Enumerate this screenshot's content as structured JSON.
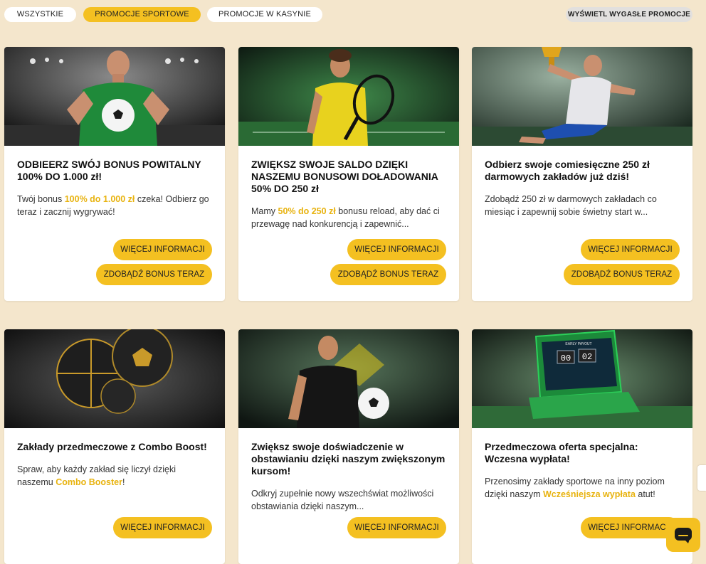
{
  "filters": {
    "all": "WSZYSTKIE",
    "sport": "PROMOCJE SPORTOWE",
    "casino": "PROMOCJE W KASYNIE",
    "expired": "WYŚWIETL WYGASŁE PROMOCJE"
  },
  "colors": {
    "accent": "#f4c021",
    "background": "#f4e6cc",
    "highlight": "#e8b30f"
  },
  "cards": [
    {
      "title": "ODBIEERZ SWÓJ BONUS POWITALNY 100% DO 1.000 zł!",
      "text_before": "Twój bonus ",
      "text_highlight": "100% do 1.000 zł",
      "text_after": " czeka! Odbierz go teraz i zacznij wygrywać!",
      "more_label": "WIĘCEJ INFORMACJI",
      "bonus_label": "ZDOBĄDŹ BONUS TERAZ"
    },
    {
      "title": "ZWIĘKSZ SWOJE SALDO DZIĘKI NASZEMU BONUSOWI DOŁADOWANIA 50% DO 250 zł",
      "text_before": "Mamy ",
      "text_highlight": "50% do 250 zł",
      "text_after": " bonusu reload, aby dać ci przewagę nad konkurencją i zapewnić...",
      "more_label": "WIĘCEJ INFORMACJI",
      "bonus_label": "ZDOBĄDŹ BONUS TERAZ"
    },
    {
      "title": "Odbierz swoje comiesięczne 250 zł darmowych zakładów już dziś!",
      "text_before": " Zdobądź 250 zł w darmowych zakładach co miesiąc i zapewnij sobie świetny start w...",
      "text_highlight": "",
      "text_after": "",
      "more_label": "WIĘCEJ INFORMACJI",
      "bonus_label": "ZDOBĄDŹ BONUS TERAZ"
    },
    {
      "title": "Zakłady przedmeczowe z Combo Boost!",
      "text_before": "Spraw, aby każdy zakład się liczył dzięki naszemu ",
      "text_highlight": "Combo Booster",
      "text_after": "!",
      "more_label": "WIĘCEJ INFORMACJI"
    },
    {
      "title": "Zwiększ swoje doświadczenie w obstawianiu dzięki naszym zwiększonym kursom!",
      "text_before": "Odkryj zupełnie nowy wszechświat możliwości obstawiania dzięki naszym...",
      "text_highlight": "",
      "text_after": "",
      "more_label": "WIĘCEJ INFORMACJI"
    },
    {
      "title": "Przedmeczowa oferta specjalna: Wczesna wypłata!",
      "text_before": "Przenosimy zakłady sportowe na inny poziom dzięki naszym ",
      "text_highlight": "Wcześniejsza wypłata",
      "text_after": " atut!",
      "more_label": "WIĘCEJ INFORMACJI"
    }
  ],
  "scoreboard": {
    "header": "EARLY PAYOUT",
    "home": "00",
    "away": "02"
  }
}
